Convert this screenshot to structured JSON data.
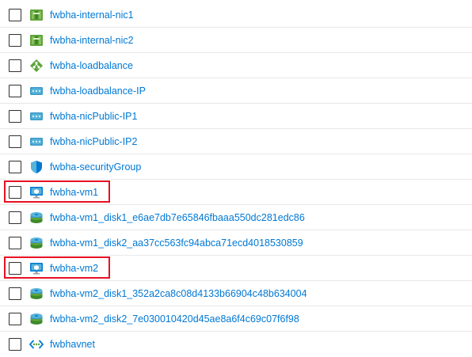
{
  "resources": [
    {
      "name": "fwbha-internal-nic1",
      "icon": "network-interface-icon"
    },
    {
      "name": "fwbha-internal-nic2",
      "icon": "network-interface-icon"
    },
    {
      "name": "fwbha-loadbalance",
      "icon": "load-balancer-icon"
    },
    {
      "name": "fwbha-loadbalance-IP",
      "icon": "public-ip-icon"
    },
    {
      "name": "fwbha-nicPublic-IP1",
      "icon": "public-ip-icon"
    },
    {
      "name": "fwbha-nicPublic-IP2",
      "icon": "public-ip-icon"
    },
    {
      "name": "fwbha-securityGroup",
      "icon": "network-security-group-icon"
    },
    {
      "name": "fwbha-vm1",
      "icon": "virtual-machine-icon",
      "highlighted": true
    },
    {
      "name": "fwbha-vm1_disk1_e6ae7db7e65846fbaaa550dc281edc86",
      "icon": "disk-icon"
    },
    {
      "name": "fwbha-vm1_disk2_aa37cc563fc94abca71ecd4018530859",
      "icon": "disk-icon"
    },
    {
      "name": "fwbha-vm2",
      "icon": "virtual-machine-icon",
      "highlighted": true
    },
    {
      "name": "fwbha-vm2_disk1_352a2ca8c08d4133b66904c48b634004",
      "icon": "disk-icon"
    },
    {
      "name": "fwbha-vm2_disk2_7e030010420d45ae8a6f4c69c07f6f98",
      "icon": "disk-icon"
    },
    {
      "name": "fwbhavnet",
      "icon": "virtual-network-icon"
    }
  ],
  "colors": {
    "link": "#0078d4",
    "highlight": "#e81123",
    "divider": "#e8e8e8"
  }
}
